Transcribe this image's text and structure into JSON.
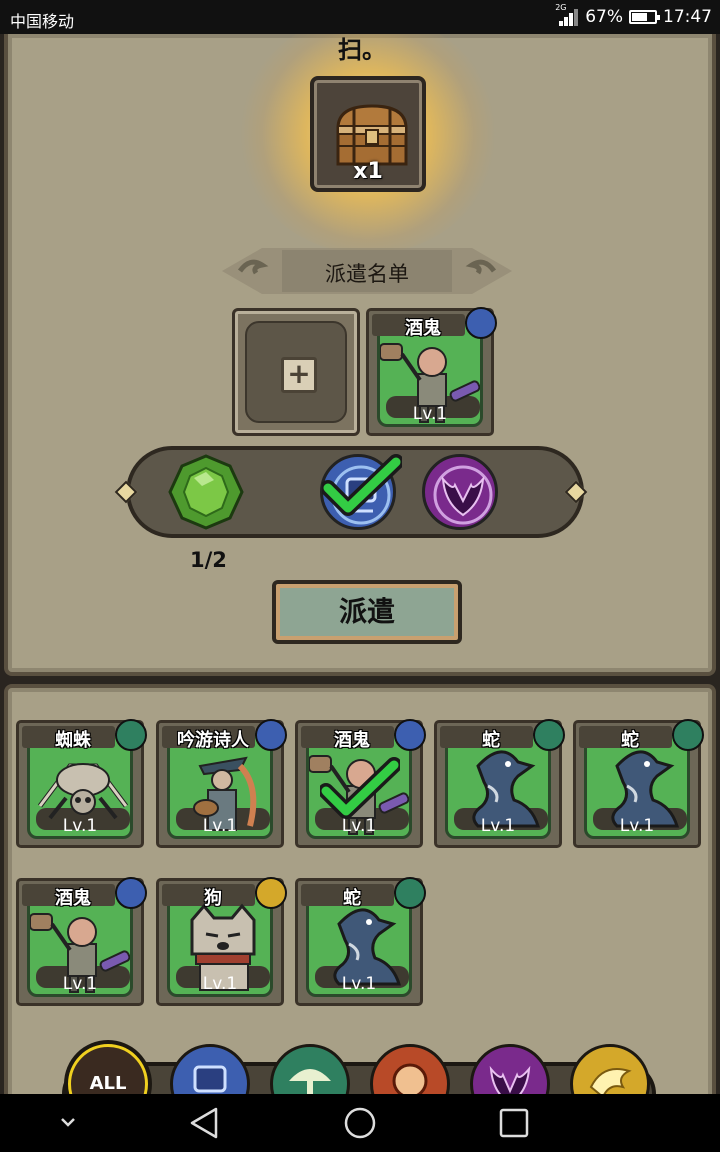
{
  "status_bar": {
    "carrier": "中国移动",
    "network": "2G",
    "battery_percent": "67%",
    "battery_level": 0.67,
    "time": "17:47"
  },
  "reward": {
    "top_text": "扫。",
    "item_icon": "treasure-chest-icon",
    "count": "x1"
  },
  "dispatch_list": {
    "title": "派遣名单",
    "slots": [
      {
        "type": "empty",
        "button": "+"
      },
      {
        "type": "hero",
        "name": "酒鬼",
        "level": "Lv.1",
        "faction": "mech"
      }
    ]
  },
  "requirements": {
    "gem_icon": "green-gem-icon",
    "progress": "1/2",
    "conditions": [
      {
        "faction": "mech",
        "met": true
      },
      {
        "faction": "shadow",
        "met": false
      }
    ]
  },
  "dispatch_button": "派遣",
  "heroes": [
    {
      "name": "蜘蛛",
      "level": "Lv.1",
      "faction": "nature",
      "selected": false,
      "art": "spider"
    },
    {
      "name": "吟游诗人",
      "level": "Lv.1",
      "faction": "mech",
      "selected": false,
      "art": "bard"
    },
    {
      "name": "酒鬼",
      "level": "Lv.1",
      "faction": "mech",
      "selected": true,
      "art": "drunkard"
    },
    {
      "name": "蛇",
      "level": "Lv.1",
      "faction": "nature",
      "selected": false,
      "art": "snake"
    },
    {
      "name": "蛇",
      "level": "Lv.1",
      "faction": "nature",
      "selected": false,
      "art": "snake"
    },
    {
      "name": "酒鬼",
      "level": "Lv.1",
      "faction": "mech",
      "selected": false,
      "art": "drunkard"
    },
    {
      "name": "狗",
      "level": "Lv.1",
      "faction": "gold",
      "selected": false,
      "art": "dog"
    },
    {
      "name": "蛇",
      "level": "Lv.1",
      "faction": "nature",
      "selected": false,
      "art": "snake"
    }
  ],
  "faction_tabs": [
    {
      "label": "ALL",
      "active": true
    },
    {
      "label": "",
      "faction": "mech"
    },
    {
      "label": "",
      "faction": "nature"
    },
    {
      "label": "",
      "faction": "fire"
    },
    {
      "label": "",
      "faction": "shadow"
    },
    {
      "label": "",
      "faction": "gold"
    }
  ],
  "colors": {
    "panel": "#a8a087",
    "card_green": "#55b255",
    "mech": "#3d5fb0",
    "nature": "#2f8060",
    "gold": "#d4a82a",
    "fire": "#b84a28",
    "shadow": "#7a2a8c",
    "check_green": "#33cc44"
  }
}
